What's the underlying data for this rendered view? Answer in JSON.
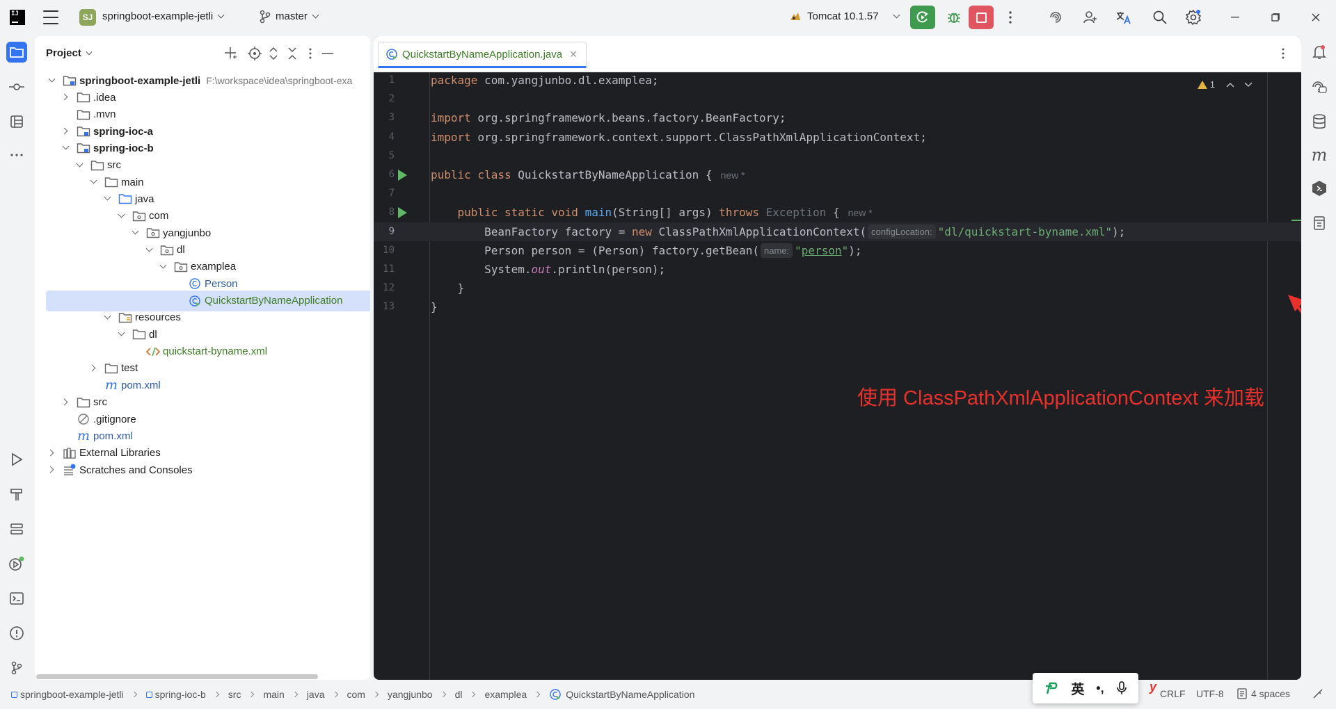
{
  "titlebar": {
    "app_logo": "JetBrains",
    "project_badge": "SJ",
    "project_name": "springboot-example-jetli",
    "branch": "master",
    "run_config": "Tomcat 10.1.57",
    "colors": {
      "run": "#3d9a4f",
      "stop": "#e05560",
      "badge": "#8da65a"
    }
  },
  "project_panel": {
    "title": "Project",
    "tree": [
      {
        "label": "springboot-example-jetli",
        "path": "F:\\workspace\\idea\\springboot-exa",
        "icon": "module-folder-icon",
        "depth": 0,
        "arrow": "down",
        "style": "bold"
      },
      {
        "label": ".idea",
        "icon": "folder-icon",
        "depth": 1,
        "arrow": "right",
        "style": ""
      },
      {
        "label": ".mvn",
        "icon": "folder-icon",
        "depth": 1,
        "arrow": "none",
        "style": ""
      },
      {
        "label": "spring-ioc-a",
        "icon": "module-folder-icon",
        "depth": 1,
        "arrow": "right",
        "style": "bold"
      },
      {
        "label": "spring-ioc-b",
        "icon": "module-folder-icon",
        "depth": 1,
        "arrow": "down",
        "style": "bold"
      },
      {
        "label": "src",
        "icon": "folder-icon",
        "depth": 2,
        "arrow": "down",
        "style": ""
      },
      {
        "label": "main",
        "icon": "folder-icon",
        "depth": 3,
        "arrow": "down",
        "style": ""
      },
      {
        "label": "java",
        "icon": "source-folder-icon",
        "depth": 4,
        "arrow": "down",
        "style": ""
      },
      {
        "label": "com",
        "icon": "package-icon",
        "depth": 5,
        "arrow": "down",
        "style": ""
      },
      {
        "label": "yangjunbo",
        "icon": "package-icon",
        "depth": 6,
        "arrow": "down",
        "style": ""
      },
      {
        "label": "dl",
        "icon": "package-icon",
        "depth": 7,
        "arrow": "down",
        "style": ""
      },
      {
        "label": "examplea",
        "icon": "package-icon",
        "depth": 8,
        "arrow": "down",
        "style": ""
      },
      {
        "label": "Person",
        "icon": "class-icon",
        "depth": 9,
        "arrow": "none",
        "style": "blue"
      },
      {
        "label": "QuickstartByNameApplication",
        "icon": "runnable-class-icon",
        "depth": 9,
        "arrow": "none",
        "style": "green",
        "selected": true
      },
      {
        "label": "resources",
        "icon": "resources-folder-icon",
        "depth": 4,
        "arrow": "down",
        "style": ""
      },
      {
        "label": "dl",
        "icon": "folder-icon",
        "depth": 5,
        "arrow": "down",
        "style": ""
      },
      {
        "label": "quickstart-byname.xml",
        "icon": "xml-file-icon",
        "depth": 6,
        "arrow": "none",
        "style": "green"
      },
      {
        "label": "test",
        "icon": "folder-icon",
        "depth": 3,
        "arrow": "right",
        "style": ""
      },
      {
        "label": "pom.xml",
        "icon": "maven-icon",
        "depth": 3,
        "arrow": "none",
        "style": "blue"
      },
      {
        "label": "src",
        "icon": "folder-icon",
        "depth": 1,
        "arrow": "right",
        "style": ""
      },
      {
        "label": ".gitignore",
        "icon": "ignored-file-icon",
        "depth": 1,
        "arrow": "none",
        "style": ""
      },
      {
        "label": "pom.xml",
        "icon": "maven-icon",
        "depth": 1,
        "arrow": "none",
        "style": "blue"
      },
      {
        "label": "External Libraries",
        "icon": "library-icon",
        "depth": 0,
        "arrow": "right",
        "style": ""
      },
      {
        "label": "Scratches and Consoles",
        "icon": "scratches-icon",
        "depth": 0,
        "arrow": "right",
        "style": ""
      }
    ]
  },
  "editor": {
    "tab_label": "QuickstartByNameApplication.java",
    "warnings": "1",
    "lines": [
      {
        "n": "1",
        "html": "<span class='kw'>package</span> com.yangjunbo.dl.examplea;"
      },
      {
        "n": "2",
        "html": ""
      },
      {
        "n": "3",
        "html": "<span class='kw'>import</span> org.springframework.beans.factory.BeanFactory;"
      },
      {
        "n": "4",
        "html": "<span class='kw'>import</span> org.springframework.context.support.ClassPathXmlApplicationContext;"
      },
      {
        "n": "5",
        "html": ""
      },
      {
        "n": "6",
        "run": true,
        "html": "<span class='kw'>public class</span> QuickstartByNameApplication {<span class='newtag'>new *</span>"
      },
      {
        "n": "7",
        "html": ""
      },
      {
        "n": "8",
        "run": true,
        "html": "    <span class='kw'>public static void</span> <span class='fn'>main</span>(String[] args) <span class='kw'>throws</span> <span class='gray'>Exception</span> {<span class='newtag'>new *</span>"
      },
      {
        "n": "9",
        "current": true,
        "html": "        BeanFactory factory = <span class='kw'>new</span> ClassPathXmlApplicationContext(<span class='hint'>configLocation:</span><span class='str'>\"dl/quickstart-byname.xml\"</span>);"
      },
      {
        "n": "10",
        "html": "        Person person = (Person) factory.getBean(<span class='hint'>name:</span><span class='str'>\"<span class='str-link'>person</span>\"</span>);"
      },
      {
        "n": "11",
        "html": "        System.<span class='ital'>out</span>.println(person);"
      },
      {
        "n": "12",
        "html": "    }"
      },
      {
        "n": "13",
        "html": "}"
      }
    ],
    "annotation": "使用 ClassPathXmlApplicationContext 来加载",
    "annotation_color": "#e8312c"
  },
  "statusbar": {
    "crumbs": [
      "springboot-example-jetli",
      "spring-ioc-b",
      "src",
      "main",
      "java",
      "com",
      "yangjunbo",
      "dl",
      "examplea",
      "QuickstartByNameApplication"
    ],
    "line_sep": "CRLF",
    "encoding": "UTF-8",
    "indent": "4 spaces"
  },
  "ime": {
    "lang": "英",
    "punct": "•,"
  }
}
